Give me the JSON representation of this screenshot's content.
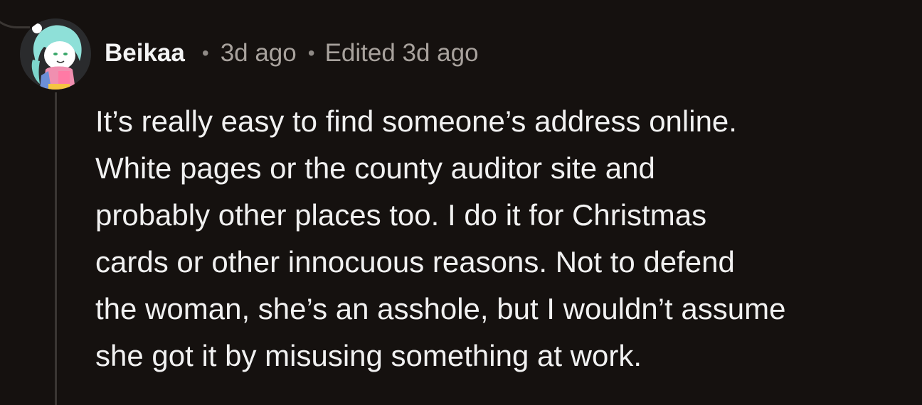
{
  "comment": {
    "author": "Beikaa",
    "timestamp": "3d ago",
    "edited": "Edited 3d ago",
    "separator": "•",
    "avatar_icon": "user-avatar-icon",
    "lines": [
      "It’s really easy to find someone’s address online.",
      "White pages or the county auditor site and",
      "probably other places too. I do it for Christmas",
      "cards or other innocuous reasons. Not to defend",
      "the woman, she’s an asshole, but I wouldn’t assume",
      "she got it by misusing something at work."
    ]
  },
  "colors": {
    "background": "#15110f",
    "thread_line": "#3a3633",
    "meta_text": "#a8a29d",
    "body_text": "#f1f1f1"
  }
}
